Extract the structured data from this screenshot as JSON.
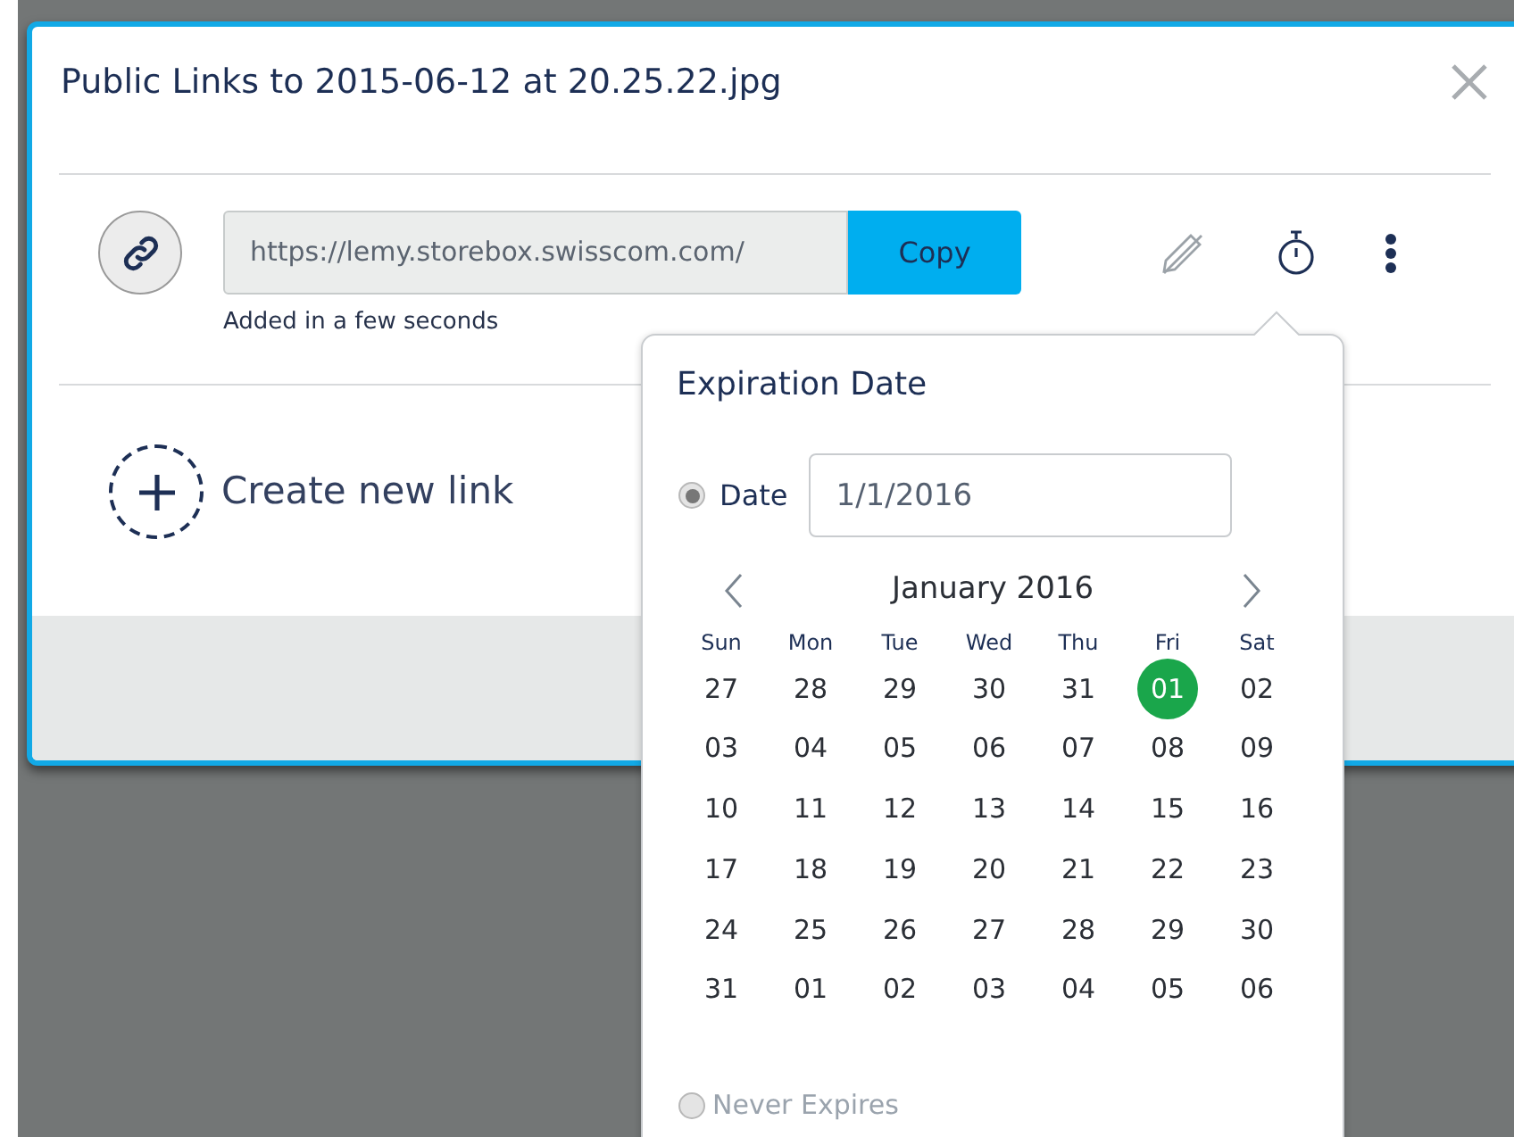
{
  "dialog": {
    "title": "Public Links to 2015-06-12 at 20.25.22.jpg",
    "link": {
      "url": "https://lemy.storebox.swisscom.com/",
      "copy_label": "Copy",
      "added": "Added in a few seconds"
    },
    "create_label": "Create new link"
  },
  "expiration_popover": {
    "title": "Expiration Date",
    "options": [
      {
        "kind": "date",
        "label": "Date",
        "selected": true,
        "value": "1/1/2016"
      },
      {
        "kind": "never",
        "label": "Never Expires",
        "selected": false
      }
    ],
    "month": "January 2016",
    "weekdays": [
      "Sun",
      "Mon",
      "Tue",
      "Wed",
      "Thu",
      "Fri",
      "Sat"
    ],
    "weeks": [
      [
        {
          "day": "27",
          "selected": false
        },
        {
          "day": "28",
          "selected": false
        },
        {
          "day": "29",
          "selected": false
        },
        {
          "day": "30",
          "selected": false
        },
        {
          "day": "31",
          "selected": false
        },
        {
          "day": "01",
          "selected": true
        },
        {
          "day": "02",
          "selected": false
        }
      ],
      [
        {
          "day": "03",
          "selected": false
        },
        {
          "day": "04",
          "selected": false
        },
        {
          "day": "05",
          "selected": false
        },
        {
          "day": "06",
          "selected": false
        },
        {
          "day": "07",
          "selected": false
        },
        {
          "day": "08",
          "selected": false
        },
        {
          "day": "09",
          "selected": false
        }
      ],
      [
        {
          "day": "10",
          "selected": false
        },
        {
          "day": "11",
          "selected": false
        },
        {
          "day": "12",
          "selected": false
        },
        {
          "day": "13",
          "selected": false
        },
        {
          "day": "14",
          "selected": false
        },
        {
          "day": "15",
          "selected": false
        },
        {
          "day": "16",
          "selected": false
        }
      ],
      [
        {
          "day": "17",
          "selected": false
        },
        {
          "day": "18",
          "selected": false
        },
        {
          "day": "19",
          "selected": false
        },
        {
          "day": "20",
          "selected": false
        },
        {
          "day": "21",
          "selected": false
        },
        {
          "day": "22",
          "selected": false
        },
        {
          "day": "23",
          "selected": false
        }
      ],
      [
        {
          "day": "24",
          "selected": false
        },
        {
          "day": "25",
          "selected": false
        },
        {
          "day": "26",
          "selected": false
        },
        {
          "day": "27",
          "selected": false
        },
        {
          "day": "28",
          "selected": false
        },
        {
          "day": "29",
          "selected": false
        },
        {
          "day": "30",
          "selected": false
        }
      ],
      [
        {
          "day": "31",
          "selected": false
        },
        {
          "day": "01",
          "selected": false
        },
        {
          "day": "02",
          "selected": false
        },
        {
          "day": "03",
          "selected": false
        },
        {
          "day": "04",
          "selected": false
        },
        {
          "day": "05",
          "selected": false
        },
        {
          "day": "06",
          "selected": false
        }
      ]
    ]
  }
}
